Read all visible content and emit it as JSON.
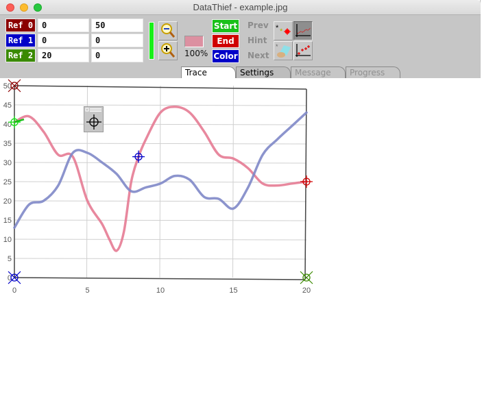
{
  "window": {
    "title": "DataThief - example.jpg"
  },
  "references": [
    {
      "label": "Ref 0",
      "x": "0",
      "y": "50",
      "color": "#8b0000"
    },
    {
      "label": "Ref 1",
      "x": "0",
      "y": "0",
      "color": "#0000c8"
    },
    {
      "label": "Ref 2",
      "x": "20",
      "y": "0",
      "color": "#3a8a00"
    }
  ],
  "zoom": {
    "zoom_out_label": "zoom-out",
    "zoom_in_label": "zoom-in",
    "level": "100%"
  },
  "trace_color": "#dc90a1",
  "actions": {
    "start": "Start",
    "end": "End",
    "color": "Color"
  },
  "navigation": {
    "prev": "Prev",
    "hint": "Hint",
    "next": "Next"
  },
  "tabs": [
    {
      "label": "Trace",
      "active": true
    },
    {
      "label": "Settings",
      "active": false
    },
    {
      "label": "Message",
      "active": false,
      "disabled": true
    },
    {
      "label": "Progress",
      "active": false,
      "disabled": true
    }
  ],
  "chart_data": {
    "type": "line",
    "title": "",
    "xlabel": "",
    "ylabel": "",
    "xlim": [
      0,
      20
    ],
    "ylim": [
      0,
      50
    ],
    "x_ticks": [
      "0",
      "5",
      "10",
      "15",
      "20"
    ],
    "y_ticks": [
      "0",
      "5",
      "10",
      "15",
      "20",
      "25",
      "30",
      "35",
      "40",
      "45",
      "50"
    ],
    "grid": true,
    "series": [
      {
        "name": "pink",
        "color": "#e57b93",
        "x": [
          0,
          1,
          2,
          3,
          4,
          5,
          6,
          6.5,
          7,
          7.5,
          8,
          8.5,
          9,
          10,
          11,
          12,
          13,
          14,
          15,
          16,
          17,
          18,
          19,
          20
        ],
        "y": [
          40.5,
          42,
          38,
          32,
          31.5,
          20,
          14,
          10,
          7,
          12,
          25,
          31.5,
          36,
          43,
          44.5,
          43,
          38,
          32,
          31,
          28.5,
          24.5,
          24,
          24.5,
          25
        ]
      },
      {
        "name": "blue",
        "color": "#8088c8",
        "x": [
          0,
          1,
          2,
          3,
          4,
          5,
          6,
          7,
          8,
          9,
          10,
          11,
          12,
          13,
          14,
          15,
          16,
          17,
          18,
          19,
          20
        ],
        "y": [
          13,
          19,
          20,
          24,
          32.5,
          32.5,
          30,
          27,
          22.5,
          23.5,
          24.5,
          26.5,
          25.5,
          21,
          20.5,
          18,
          23.5,
          32,
          36,
          39.5,
          43
        ]
      }
    ],
    "markers": [
      {
        "name": "ref0-marker",
        "x": 0,
        "y": 50,
        "color": "#8b0000"
      },
      {
        "name": "ref1-marker",
        "x": 0,
        "y": 0,
        "color": "#0000c8"
      },
      {
        "name": "ref2-marker",
        "x": 20,
        "y": 0,
        "color": "#3a8a00"
      },
      {
        "name": "start-marker",
        "x": 0,
        "y": 40.5,
        "color": "#18e018"
      },
      {
        "name": "color-marker",
        "x": 8.5,
        "y": 31.5,
        "color": "#0000c8"
      },
      {
        "name": "end-marker",
        "x": 20,
        "y": 25,
        "color": "#d00000"
      }
    ]
  }
}
